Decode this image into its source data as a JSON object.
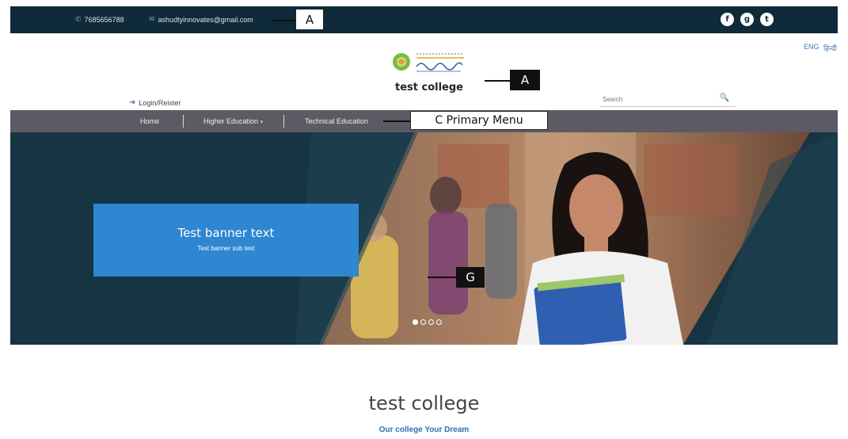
{
  "topbar": {
    "phone": "7685656788",
    "email": "ashudtyinnovates@gmail.com",
    "phone_icon": "phone-icon",
    "email_icon": "envelope-icon",
    "social": [
      {
        "name": "facebook-icon",
        "glyph": "f"
      },
      {
        "name": "google-plus-icon",
        "glyph": "g"
      },
      {
        "name": "twitter-icon",
        "glyph": "t"
      }
    ]
  },
  "annotations": {
    "a_top": "A",
    "a_header": "A",
    "c_menu": "C  Primary Menu",
    "g_banner": "G"
  },
  "language": {
    "eng": "ENG",
    "hindi": "हिन्दी"
  },
  "header": {
    "title": "test college",
    "login_label": "Login/Reister",
    "search_placeholder": "Search"
  },
  "nav": {
    "items": [
      {
        "label": "Home"
      },
      {
        "label": "Higher Education"
      },
      {
        "label": "Technical Education"
      }
    ],
    "dropdown_indicator": "▾"
  },
  "banner": {
    "title": "Test banner text",
    "subtitle": "Test banner sub text",
    "slides": 4,
    "active_slide": 1
  },
  "content": {
    "title": "test college",
    "tagline": "Our college Your Dream"
  },
  "colors": {
    "topbar": "#0f2a38",
    "nav": "#5d5a64",
    "banner_box": "#2f86d1",
    "accent": "#3a7bbf"
  }
}
